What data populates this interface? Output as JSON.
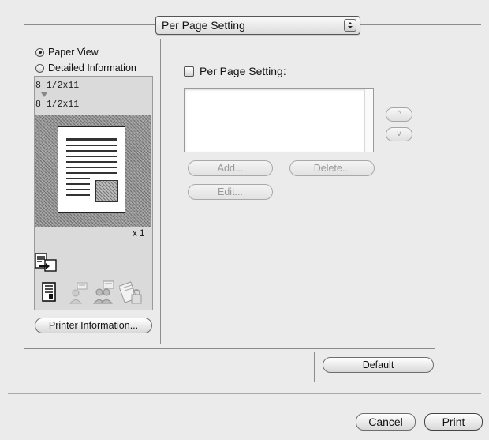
{
  "header": {
    "popup_value": "Per Page Setting"
  },
  "view_options": [
    {
      "label": "Paper View",
      "selected": true
    },
    {
      "label": "Detailed Information",
      "selected": false
    }
  ],
  "preview": {
    "input_size": "8 1/2x11",
    "output_size": "8 1/2x11",
    "copies": "x 1"
  },
  "left_panel": {
    "printer_info_button": "Printer Information..."
  },
  "icons": [
    "copy-to-tray-icon",
    "document-icon",
    "user-account-icon",
    "user-auth-icon",
    "secure-print-icon"
  ],
  "per_page": {
    "checkbox_label": "Per Page Setting:",
    "checked": false,
    "add_button": "Add...",
    "delete_button": "Delete...",
    "edit_button": "Edit...",
    "up_glyph": "^",
    "down_glyph": "v"
  },
  "footer": {
    "default_button": "Default",
    "cancel_button": "Cancel",
    "print_button": "Print"
  }
}
